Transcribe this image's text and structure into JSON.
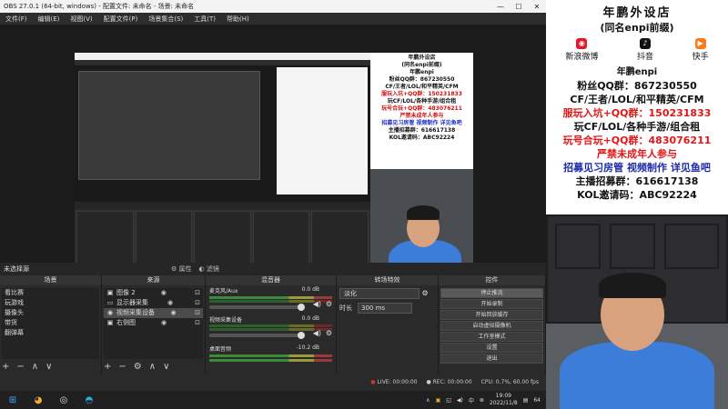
{
  "window": {
    "title": "OBS 27.0.1 (64-bit, windows) - 配置文件: 未命名 - 场景: 未命名",
    "controls": [
      "—",
      "☐",
      "✕"
    ]
  },
  "menu": [
    "文件(F)",
    "编辑(E)",
    "视图(V)",
    "配置文件(P)",
    "场景集合(S)",
    "工具(T)",
    "帮助(H)"
  ],
  "source_status": "未选择源",
  "source_props": "属性",
  "source_filters": "滤镜",
  "docks": {
    "scenes_title": "场景",
    "scenes": [
      "看比赛",
      "玩游戏",
      "摄像头",
      "带货",
      "翻弹幕"
    ],
    "sources_title": "来源",
    "sources": [
      {
        "icon": "image-icon",
        "glyph": "▣",
        "name": "图像 2"
      },
      {
        "icon": "monitor-icon",
        "glyph": "▭",
        "name": "显示器采集"
      },
      {
        "icon": "camera-icon",
        "glyph": "◉",
        "name": "视频采集设备"
      },
      {
        "icon": "image-icon",
        "glyph": "▣",
        "name": "右侧图"
      }
    ],
    "mixer_title": "混音器",
    "mixer": [
      {
        "name": "麦克风/Aux",
        "db": "0.0 dB"
      },
      {
        "name": "视频采集设备",
        "db": "0.0 dB"
      },
      {
        "name": "桌面音频",
        "db": "-10.2 dB"
      }
    ],
    "trans_title": "转场特效",
    "transition": "淡化",
    "duration_label": "时长",
    "duration": "300 ms",
    "controls_title": "控件",
    "control_buttons": [
      "停止推流",
      "开始录制",
      "开始回放缓存",
      "启动虚拟摄像机",
      "工作室模式",
      "设置",
      "退出"
    ]
  },
  "status": {
    "live": "LIVE: 00:00:00",
    "rec": "REC: 00:00:00",
    "cpu": "CPU: 0.7%, 60.00 fps"
  },
  "taskbar": {
    "time": "19:09",
    "date": "2022/11/8",
    "ime": "中",
    "num": "64"
  },
  "poster": {
    "title": "年鹏外设店",
    "subtitle": "(同名enpi前缀)",
    "weibo": "新浪微博",
    "douyin": "抖音",
    "kuaishou": "快手",
    "name": "年鹏enpi",
    "lines": [
      {
        "text": "粉丝QQ群：867230550",
        "color": "black"
      },
      {
        "text": "CF/王者/LOL/和平精英/CFM",
        "color": "black"
      },
      {
        "text": "服玩入坑+QQ群：150231833",
        "color": "red"
      },
      {
        "text": "玩CF/LOL/各种手游/组合租",
        "color": "black"
      },
      {
        "text": "玩号合玩+QQ群：483076211",
        "color": "red"
      },
      {
        "text": "严禁未成年人参与",
        "color": "red"
      },
      {
        "text": "招募见习房管 视频制作 详见鱼吧",
        "color": "mixed"
      },
      {
        "text": "主播招募群：616617138",
        "color": "black"
      },
      {
        "text": "KOL邀请码：ABC92224",
        "color": "black"
      }
    ]
  }
}
